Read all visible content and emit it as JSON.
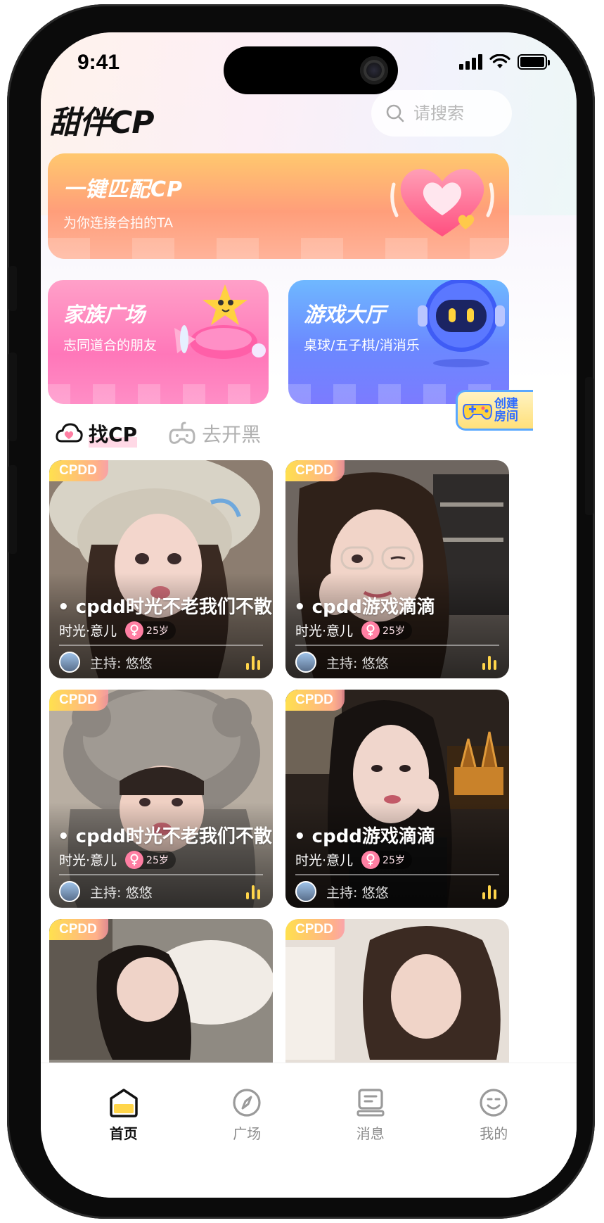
{
  "status_bar": {
    "time": "9:41"
  },
  "header": {
    "app_title": "甜伴CP",
    "search_placeholder": "请搜索",
    "search_icon": "search-icon"
  },
  "match_banner": {
    "title": "一键匹配CP",
    "subtitle": "为你连接合拍的TA"
  },
  "feature_cards": [
    {
      "title": "家族广场",
      "subtitle": "志同道合的朋友"
    },
    {
      "title": "游戏大厅",
      "subtitle": "桌球/五子棋/消消乐"
    }
  ],
  "create_room": {
    "label": "创建房间"
  },
  "tabs": [
    {
      "label": "找CP",
      "icon": "heart-cloud-icon",
      "active": true
    },
    {
      "label": "去开黑",
      "icon": "gamepad-icon",
      "active": false
    }
  ],
  "rooms": [
    {
      "tag": "CPDD",
      "name": "cpdd时光不老我们不散",
      "subname": "时光·意儿",
      "age": "25岁",
      "host": "主持:  悠悠"
    },
    {
      "tag": "CPDD",
      "name": "cpdd游戏滴滴",
      "subname": "时光·意儿",
      "age": "25岁",
      "host": "主持:  悠悠"
    },
    {
      "tag": "CPDD",
      "name": "cpdd时光不老我们不散",
      "subname": "时光·意儿",
      "age": "25岁",
      "host": "主持:  悠悠"
    },
    {
      "tag": "CPDD",
      "name": "cpdd游戏滴滴",
      "subname": "时光·意儿",
      "age": "25岁",
      "host": "主持:  悠悠"
    },
    {
      "tag": "CPDD"
    },
    {
      "tag": "CPDD"
    }
  ],
  "bottom_nav": [
    {
      "label": "首页",
      "icon": "home-icon",
      "active": true
    },
    {
      "label": "广场",
      "icon": "compass-icon",
      "active": false
    },
    {
      "label": "消息",
      "icon": "message-icon",
      "active": false
    },
    {
      "label": "我的",
      "icon": "smile-icon",
      "active": false
    }
  ],
  "colors": {
    "accent_yellow": "#ffd54a",
    "accent_pink": "#ff7fa3",
    "text_dark": "#111111",
    "text_muted": "#8a8a8a"
  }
}
